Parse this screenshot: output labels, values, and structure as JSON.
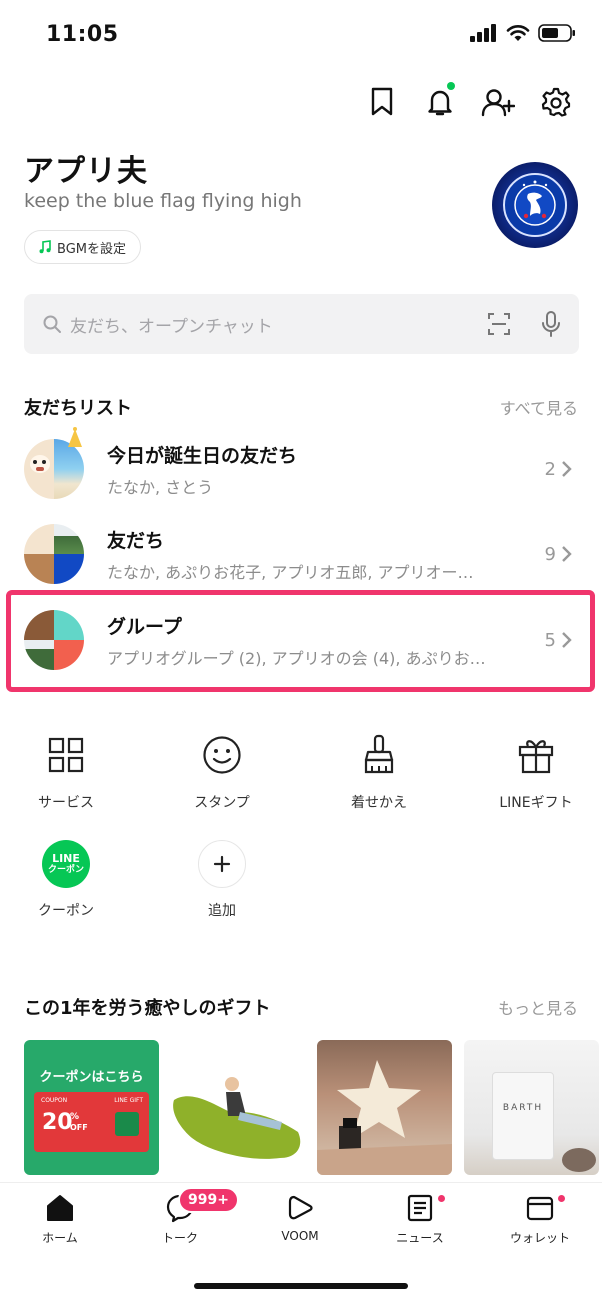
{
  "status_bar": {
    "time": "11:05"
  },
  "profile": {
    "name": "アプリ夫",
    "status_message": "keep the blue flag flying high",
    "bgm_label": "BGMを設定"
  },
  "search": {
    "placeholder": "友だち、オープンチャット"
  },
  "friends_section": {
    "title": "友だちリスト",
    "see_all": "すべて見る",
    "rows": [
      {
        "title": "今日が誕生日の友だち",
        "subtitle": "たなか, さとう",
        "count": "2"
      },
      {
        "title": "友だち",
        "subtitle": "たなか, あぷりお花子, アプリオ五郎, アプリオー…",
        "count": "9"
      },
      {
        "title": "グループ",
        "subtitle": "アプリオグループ (2), アプリオの会 (4), あぷりお…",
        "count": "5"
      }
    ]
  },
  "services": [
    {
      "label": "サービス",
      "icon": "grid-icon"
    },
    {
      "label": "スタンプ",
      "icon": "smiley-icon"
    },
    {
      "label": "着せかえ",
      "icon": "brush-icon"
    },
    {
      "label": "LINEギフト",
      "icon": "gift-icon"
    },
    {
      "label": "クーポン",
      "icon": "line-coupon-icon",
      "icon_text_1": "LINE",
      "icon_text_2": "クーポン"
    },
    {
      "label": "追加",
      "icon": "plus-icon"
    }
  ],
  "gift_section": {
    "title": "この1年を労う癒やしのギフト",
    "see_more": "もっと見る",
    "coupon_card": {
      "headline": "クーポンはこちら",
      "coupon_tag": "COUPON",
      "gift_tag": "LINE GIFT",
      "percent": "20",
      "percent_sign": "%",
      "off": "OFF"
    },
    "product_text": "BARTH"
  },
  "nav": {
    "items": [
      {
        "label": "ホーム",
        "icon": "home-icon"
      },
      {
        "label": "トーク",
        "icon": "chat-icon",
        "badge": "999+"
      },
      {
        "label": "VOOM",
        "icon": "voom-icon"
      },
      {
        "label": "ニュース",
        "icon": "news-icon"
      },
      {
        "label": "ウォレット",
        "icon": "wallet-icon"
      }
    ]
  },
  "colors": {
    "accent_green": "#06c755",
    "highlight_pink": "#f0356c",
    "badge_red": "#f0356c",
    "chelsea_blue": "#1d4fd6"
  }
}
